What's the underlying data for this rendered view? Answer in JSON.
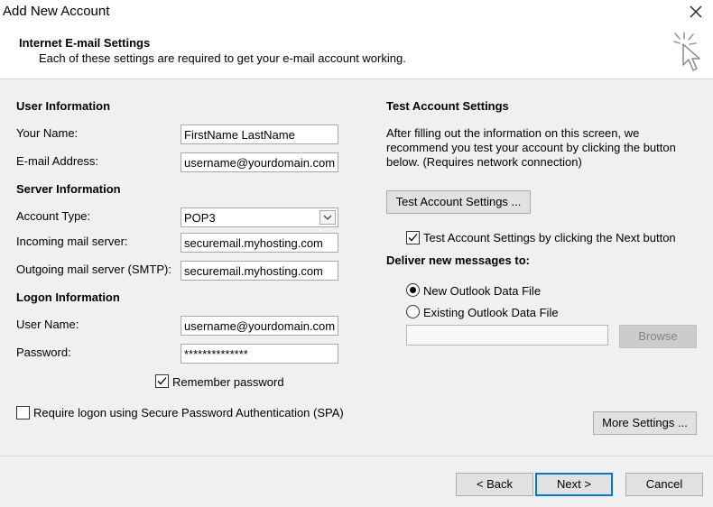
{
  "window": {
    "title": "Add New Account",
    "close_symbol": "✕"
  },
  "header": {
    "title": "Internet E-mail Settings",
    "subtitle": "Each of these settings are required to get your e-mail account working."
  },
  "user_info": {
    "heading": "User Information",
    "name_label": "Your Name:",
    "name_value": "FirstName LastName",
    "email_label": "E-mail Address:",
    "email_value": "username@yourdomain.com"
  },
  "server_info": {
    "heading": "Server Information",
    "account_type_label": "Account Type:",
    "account_type_value": "POP3",
    "incoming_label": "Incoming mail server:",
    "incoming_value": "securemail.myhosting.com",
    "outgoing_label": "Outgoing mail server (SMTP):",
    "outgoing_value": "securemail.myhosting.com"
  },
  "logon_info": {
    "heading": "Logon Information",
    "username_label": "User Name:",
    "username_value": "username@yourdomain.com",
    "password_label": "Password:",
    "password_value": "**************",
    "remember_label": "Remember password",
    "remember_checked": true,
    "spa_label": "Require logon using Secure Password Authentication (SPA)",
    "spa_checked": false
  },
  "test_settings": {
    "heading": "Test Account Settings",
    "description_line1": "After filling out the information on this screen, we",
    "description_line2": "recommend you test your account by clicking the button",
    "description_line3": "below. (Requires network connection)",
    "test_button": "Test Account Settings ...",
    "auto_test_label": "Test Account Settings by clicking the Next button",
    "auto_test_checked": true
  },
  "deliver": {
    "heading": "Deliver new messages to:",
    "option_new": "New Outlook Data File",
    "option_existing": "Existing Outlook Data File",
    "selected": "new",
    "path_value": "",
    "browse_button": "Browse"
  },
  "buttons": {
    "more_settings": "More Settings ...",
    "back": "< Back",
    "next": "Next >",
    "cancel": "Cancel"
  },
  "icons": {
    "close": "close-icon",
    "header": "cursor-sparkle-icon",
    "dropdown": "chevron-down-icon",
    "check": "checkmark-icon"
  }
}
